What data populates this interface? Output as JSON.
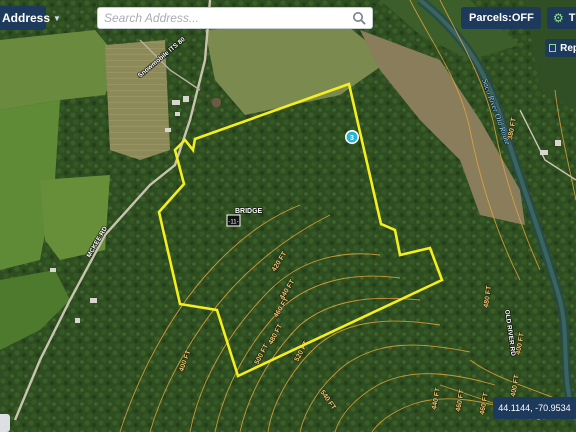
{
  "toolbar": {
    "layer_menu_label": "Address",
    "search_placeholder": "Search Address...",
    "search_value": "",
    "parcels_label": "Parcels:",
    "parcels_value": "OFF",
    "tools_label": "T",
    "report_label": "Rep"
  },
  "map": {
    "feature_label": "BRIDGE",
    "feature_marker": "-11-",
    "pin_icon": "numbered-pin",
    "pin_number": "3",
    "roads": [
      "Snowmobile ITS 80",
      "MCKEE RD",
      "OLD RIVER RD"
    ],
    "river_label": "Saco River Old Route",
    "contour_labels": [
      "420 FT",
      "440 FT",
      "460 FT",
      "480 FT",
      "500 FT",
      "520 FT",
      "540 FT",
      "480 FT",
      "400 FT",
      "380 FT",
      "400 FT",
      "440 FT",
      "460 FT",
      "460 FT",
      "400 FT"
    ],
    "parcel_outline_color": "#f5ee1f",
    "contour_color": "#e3a53a",
    "coordinates": "44.1144, -70.9534"
  }
}
